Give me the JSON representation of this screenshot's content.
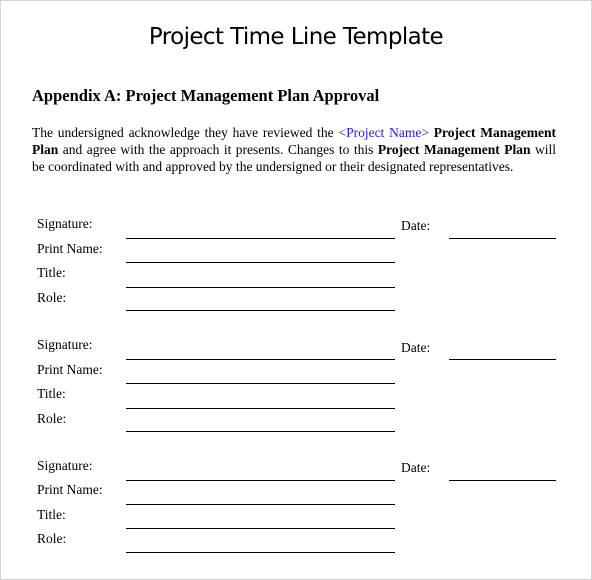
{
  "document": {
    "title": "Project Time Line Template",
    "heading": "Appendix A: Project Management Plan Approval",
    "paragraph": {
      "t1": "The undersigned acknowledge they have reviewed the ",
      "placeholder": "<Project Name>",
      "b1": " Project Management Plan",
      "t2": " and agree with the approach it presents. Changes to this ",
      "b2": "Project Management Plan",
      "t3": " will be coordinated with and approved by the undersigned or their designated representatives."
    },
    "placeholder_color": "#1a1aff",
    "signature_blocks": [
      {
        "signature_label": "Signature:",
        "print_name_label": "Print Name:",
        "title_label": "Title:",
        "role_label": "Role:",
        "date_label": "Date:"
      },
      {
        "signature_label": "Signature:",
        "print_name_label": "Print Name:",
        "title_label": "Title:",
        "role_label": "Role:",
        "date_label": "Date:"
      },
      {
        "signature_label": "Signature:",
        "print_name_label": "Print Name:",
        "title_label": "Title:",
        "role_label": "Role:",
        "date_label": "Date:"
      }
    ]
  }
}
